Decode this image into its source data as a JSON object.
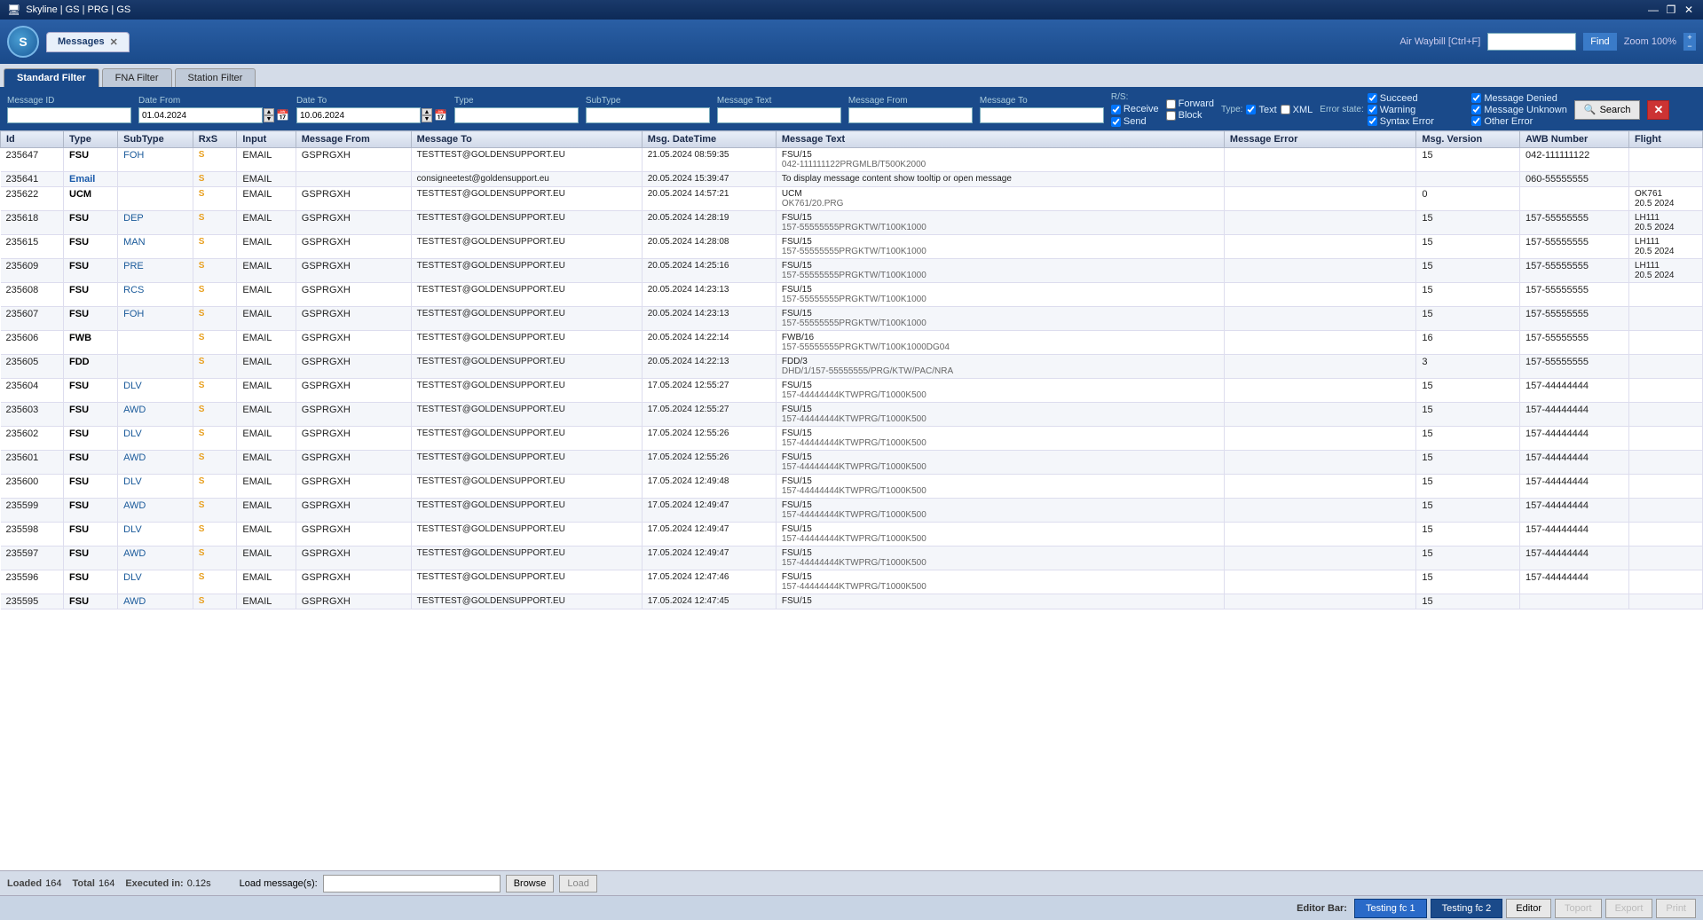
{
  "titlebar": {
    "title": "Skyline | GS | PRG | GS",
    "btns": [
      "—",
      "❐",
      "✕"
    ]
  },
  "appbar": {
    "logo": "S",
    "tab_label": "Messages",
    "tab_close": "✕",
    "top_right": {
      "label": "Air Waybill [Ctrl+F]",
      "find_placeholder": "",
      "find_btn": "Find",
      "zoom_label": "Zoom 100%"
    }
  },
  "filter_tabs": [
    {
      "label": "Standard Filter",
      "active": true
    },
    {
      "label": "FNA Filter",
      "active": false
    },
    {
      "label": "Station Filter",
      "active": false
    }
  ],
  "filter": {
    "msg_id_label": "Message ID",
    "date_from_label": "Date From",
    "date_from_value": "01.04.2024",
    "date_to_label": "Date To",
    "date_to_value": "10.06.2024",
    "type_label": "Type",
    "subtype_label": "SubType",
    "message_text_label": "Message Text",
    "message_from_label": "Message From",
    "message_to_label": "Message To",
    "rs_label": "R/S:",
    "receive_label": "Receive",
    "send_label": "Send",
    "forward_label": "Forward",
    "block_label": "Block",
    "type_check_label": "Type:",
    "text_label": "Text",
    "xml_label": "XML",
    "error_state_label": "Error state:",
    "succeed_label": "Succeed",
    "warning_label": "Warning",
    "syntax_error_label": "Syntax Error",
    "message_denied_label": "Message Denied",
    "message_unknown_label": "Message Unknown",
    "other_error_label": "Other Error",
    "search_btn": "Search",
    "clear_btn": "✕"
  },
  "table": {
    "columns": [
      "Id",
      "Type",
      "SubType",
      "RxS",
      "Input",
      "Message From",
      "Message To",
      "Msg. DateTime",
      "Message Text",
      "Message Error",
      "Msg. Version",
      "AWB Number",
      "Flight"
    ],
    "rows": [
      {
        "id": "235647",
        "type": "FSU",
        "subtype": "FOH",
        "rxs": "S",
        "input": "EMAIL",
        "from": "GSPRGXH",
        "to": "TESTTEST@GOLDENSUPPORT.EU",
        "datetime": "21.05.2024 08:59:35",
        "text": "FSU/15",
        "text2": "042-111111122PRGMLB/T500K2000",
        "error": "",
        "version": "15",
        "awb": "042-111111122",
        "flight": ""
      },
      {
        "id": "235641",
        "type": "Email",
        "subtype": "",
        "rxs": "S",
        "input": "EMAIL",
        "from": "",
        "to": "consigneetest@goldensupport.eu",
        "datetime": "20.05.2024 15:39:47",
        "text": "To display message content show tooltip or open message",
        "text2": "",
        "error": "",
        "version": "",
        "awb": "060-55555555",
        "flight": ""
      },
      {
        "id": "235622",
        "type": "UCM",
        "subtype": "",
        "rxs": "S",
        "input": "EMAIL",
        "from": "GSPRGXH",
        "to": "TESTTEST@GOLDENSUPPORT.EU",
        "datetime": "20.05.2024 14:57:21",
        "text": "UCM",
        "text2": "OK761/20.PRG",
        "error": "",
        "version": "0",
        "awb": "",
        "flight": "OK761\n20.5 2024"
      },
      {
        "id": "235618",
        "type": "FSU",
        "subtype": "DEP",
        "rxs": "S",
        "input": "EMAIL",
        "from": "GSPRGXH",
        "to": "TESTTEST@GOLDENSUPPORT.EU",
        "datetime": "20.05.2024 14:28:19",
        "text": "FSU/15",
        "text2": "157-55555555PRGKTW/T100K1000",
        "error": "",
        "version": "15",
        "awb": "157-55555555",
        "flight": "LH111\n20.5 2024"
      },
      {
        "id": "235615",
        "type": "FSU",
        "subtype": "MAN",
        "rxs": "S",
        "input": "EMAIL",
        "from": "GSPRGXH",
        "to": "TESTTEST@GOLDENSUPPORT.EU",
        "datetime": "20.05.2024 14:28:08",
        "text": "FSU/15",
        "text2": "157-55555555PRGKTW/T100K1000",
        "error": "",
        "version": "15",
        "awb": "157-55555555",
        "flight": "LH111\n20.5 2024"
      },
      {
        "id": "235609",
        "type": "FSU",
        "subtype": "PRE",
        "rxs": "S",
        "input": "EMAIL",
        "from": "GSPRGXH",
        "to": "TESTTEST@GOLDENSUPPORT.EU",
        "datetime": "20.05.2024 14:25:16",
        "text": "FSU/15",
        "text2": "157-55555555PRGKTW/T100K1000",
        "error": "",
        "version": "15",
        "awb": "157-55555555",
        "flight": "LH111\n20.5 2024"
      },
      {
        "id": "235608",
        "type": "FSU",
        "subtype": "RCS",
        "rxs": "S",
        "input": "EMAIL",
        "from": "GSPRGXH",
        "to": "TESTTEST@GOLDENSUPPORT.EU",
        "datetime": "20.05.2024 14:23:13",
        "text": "FSU/15",
        "text2": "157-55555555PRGKTW/T100K1000",
        "error": "",
        "version": "15",
        "awb": "157-55555555",
        "flight": ""
      },
      {
        "id": "235607",
        "type": "FSU",
        "subtype": "FOH",
        "rxs": "S",
        "input": "EMAIL",
        "from": "GSPRGXH",
        "to": "TESTTEST@GOLDENSUPPORT.EU",
        "datetime": "20.05.2024 14:23:13",
        "text": "FSU/15",
        "text2": "157-55555555PRGKTW/T100K1000",
        "error": "",
        "version": "15",
        "awb": "157-55555555",
        "flight": ""
      },
      {
        "id": "235606",
        "type": "FWB",
        "subtype": "",
        "rxs": "S",
        "input": "EMAIL",
        "from": "GSPRGXH",
        "to": "TESTTEST@GOLDENSUPPORT.EU",
        "datetime": "20.05.2024 14:22:14",
        "text": "FWB/16",
        "text2": "157-55555555PRGKTW/T100K1000DG04",
        "error": "",
        "version": "16",
        "awb": "157-55555555",
        "flight": ""
      },
      {
        "id": "235605",
        "type": "FDD",
        "subtype": "",
        "rxs": "S",
        "input": "EMAIL",
        "from": "GSPRGXH",
        "to": "TESTTEST@GOLDENSUPPORT.EU",
        "datetime": "20.05.2024 14:22:13",
        "text": "FDD/3",
        "text2": "DHD/1/157-55555555/PRG/KTW/PAC/NRA",
        "error": "",
        "version": "3",
        "awb": "157-55555555",
        "flight": ""
      },
      {
        "id": "235604",
        "type": "FSU",
        "subtype": "DLV",
        "rxs": "S",
        "input": "EMAIL",
        "from": "GSPRGXH",
        "to": "TESTTEST@GOLDENSUPPORT.EU",
        "datetime": "17.05.2024 12:55:27",
        "text": "FSU/15",
        "text2": "157-44444444KTWPRG/T1000K500",
        "error": "",
        "version": "15",
        "awb": "157-44444444",
        "flight": ""
      },
      {
        "id": "235603",
        "type": "FSU",
        "subtype": "AWD",
        "rxs": "S",
        "input": "EMAIL",
        "from": "GSPRGXH",
        "to": "TESTTEST@GOLDENSUPPORT.EU",
        "datetime": "17.05.2024 12:55:27",
        "text": "FSU/15",
        "text2": "157-44444444KTWPRG/T1000K500",
        "error": "",
        "version": "15",
        "awb": "157-44444444",
        "flight": ""
      },
      {
        "id": "235602",
        "type": "FSU",
        "subtype": "DLV",
        "rxs": "S",
        "input": "EMAIL",
        "from": "GSPRGXH",
        "to": "TESTTEST@GOLDENSUPPORT.EU",
        "datetime": "17.05.2024 12:55:26",
        "text": "FSU/15",
        "text2": "157-44444444KTWPRG/T1000K500",
        "error": "",
        "version": "15",
        "awb": "157-44444444",
        "flight": ""
      },
      {
        "id": "235601",
        "type": "FSU",
        "subtype": "AWD",
        "rxs": "S",
        "input": "EMAIL",
        "from": "GSPRGXH",
        "to": "TESTTEST@GOLDENSUPPORT.EU",
        "datetime": "17.05.2024 12:55:26",
        "text": "FSU/15",
        "text2": "157-44444444KTWPRG/T1000K500",
        "error": "",
        "version": "15",
        "awb": "157-44444444",
        "flight": ""
      },
      {
        "id": "235600",
        "type": "FSU",
        "subtype": "DLV",
        "rxs": "S",
        "input": "EMAIL",
        "from": "GSPRGXH",
        "to": "TESTTEST@GOLDENSUPPORT.EU",
        "datetime": "17.05.2024 12:49:48",
        "text": "FSU/15",
        "text2": "157-44444444KTWPRG/T1000K500",
        "error": "",
        "version": "15",
        "awb": "157-44444444",
        "flight": ""
      },
      {
        "id": "235599",
        "type": "FSU",
        "subtype": "AWD",
        "rxs": "S",
        "input": "EMAIL",
        "from": "GSPRGXH",
        "to": "TESTTEST@GOLDENSUPPORT.EU",
        "datetime": "17.05.2024 12:49:47",
        "text": "FSU/15",
        "text2": "157-44444444KTWPRG/T1000K500",
        "error": "",
        "version": "15",
        "awb": "157-44444444",
        "flight": ""
      },
      {
        "id": "235598",
        "type": "FSU",
        "subtype": "DLV",
        "rxs": "S",
        "input": "EMAIL",
        "from": "GSPRGXH",
        "to": "TESTTEST@GOLDENSUPPORT.EU",
        "datetime": "17.05.2024 12:49:47",
        "text": "FSU/15",
        "text2": "157-44444444KTWPRG/T1000K500",
        "error": "",
        "version": "15",
        "awb": "157-44444444",
        "flight": ""
      },
      {
        "id": "235597",
        "type": "FSU",
        "subtype": "AWD",
        "rxs": "S",
        "input": "EMAIL",
        "from": "GSPRGXH",
        "to": "TESTTEST@GOLDENSUPPORT.EU",
        "datetime": "17.05.2024 12:49:47",
        "text": "FSU/15",
        "text2": "157-44444444KTWPRG/T1000K500",
        "error": "",
        "version": "15",
        "awb": "157-44444444",
        "flight": ""
      },
      {
        "id": "235596",
        "type": "FSU",
        "subtype": "DLV",
        "rxs": "S",
        "input": "EMAIL",
        "from": "GSPRGXH",
        "to": "TESTTEST@GOLDENSUPPORT.EU",
        "datetime": "17.05.2024 12:47:46",
        "text": "FSU/15",
        "text2": "157-44444444KTWPRG/T1000K500",
        "error": "",
        "version": "15",
        "awb": "157-44444444",
        "flight": ""
      },
      {
        "id": "235595",
        "type": "FSU",
        "subtype": "AWD",
        "rxs": "S",
        "input": "EMAIL",
        "from": "GSPRGXH",
        "to": "TESTTEST@GOLDENSUPPORT.EU",
        "datetime": "17.05.2024 12:47:45",
        "text": "FSU/15",
        "text2": "",
        "error": "",
        "version": "15",
        "awb": "",
        "flight": ""
      }
    ]
  },
  "statusbar": {
    "loaded_label": "Loaded",
    "loaded_value": "164",
    "total_label": "Total",
    "total_value": "164",
    "executed_label": "Executed in:",
    "executed_value": "0.12s",
    "load_msg_label": "Load message(s):",
    "browse_btn": "Browse",
    "load_btn": "Load"
  },
  "editorbar": {
    "label": "Editor Bar:",
    "tab1": "Testing fc 1",
    "tab2": "Testing fc 2",
    "editor_btn": "Editor",
    "btn1": "Toport",
    "btn2": "Export",
    "btn3": "Print"
  }
}
